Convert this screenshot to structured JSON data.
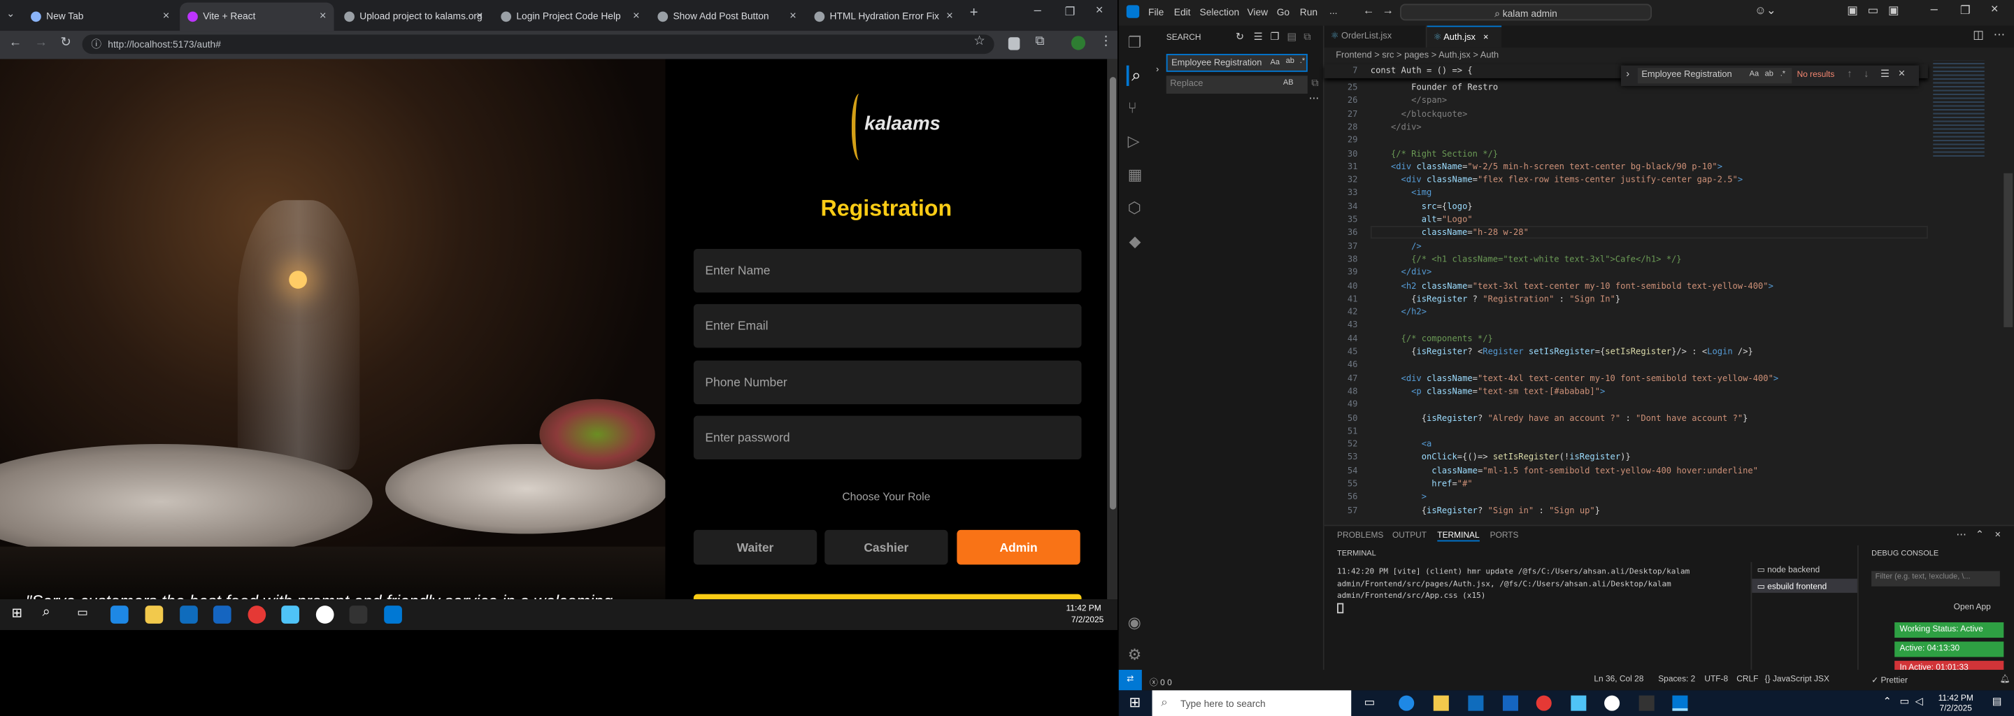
{
  "browser": {
    "tabs": [
      {
        "label": "New Tab",
        "favicon_color": "#8ab4f8"
      },
      {
        "label": "Vite + React",
        "favicon_color": "#bd34fe"
      },
      {
        "label": "Upload project to kalams.org",
        "favicon_color": "#9aa0a6"
      },
      {
        "label": "Login Project Code Help",
        "favicon_color": "#9aa0a6"
      },
      {
        "label": "Show Add Post Button",
        "favicon_color": "#9aa0a6"
      },
      {
        "label": "HTML Hydration Error Fix",
        "favicon_color": "#9aa0a6"
      }
    ],
    "new_tab": "+",
    "url": "http://localhost:5173/auth#"
  },
  "app": {
    "logo_text": "kalaams",
    "heading": "Registration",
    "name_placeholder": "Enter Name",
    "email_placeholder": "Enter Email",
    "phone_placeholder": "Phone Number",
    "password_placeholder": "Enter password",
    "role_label": "Choose Your Role",
    "roles": [
      "Waiter",
      "Cashier",
      "Admin"
    ],
    "selected_role": "Admin",
    "quote": "\"Serve customers the best food with prompt and friendly service in a welcoming",
    "accent": "#f97316",
    "heading_color": "#facc15"
  },
  "taskbar_small": {
    "time": "11:42 PM",
    "date": "7/2/2025"
  },
  "vscode": {
    "menu": [
      "File",
      "Edit",
      "Selection",
      "View",
      "Go",
      "Run",
      "..."
    ],
    "search_box": "kalam admin",
    "tabs": [
      "OrderList.jsx",
      "Auth.jsx"
    ],
    "breadcrumb": "Frontend > src > pages > Auth.jsx > Auth",
    "search": {
      "title": "SEARCH",
      "query": "Employee Registration",
      "replace_placeholder": "Replace",
      "replace_btn": "AB"
    },
    "find": {
      "query": "Employee Registration",
      "result": "No results",
      "opt_case": "Aa",
      "opt_word": "ab",
      "opt_regex": ".*"
    },
    "sticky": "const Auth = () => {",
    "sticky_ln": "7",
    "lines": [
      {
        "n": "25",
        "c": [
          [
            "    ",
            "tx"
          ],
          [
            "Founder of Restro",
            "tx"
          ]
        ]
      },
      {
        "n": "26",
        "c": [
          [
            "    ",
            "tx"
          ],
          [
            "</span>",
            "t"
          ]
        ]
      },
      {
        "n": "27",
        "c": [
          [
            "  ",
            "tx"
          ],
          [
            "</blockquote>",
            "t"
          ]
        ]
      },
      {
        "n": "28",
        "c": [
          [
            "</div>",
            "t"
          ]
        ]
      },
      {
        "n": "29",
        "c": [
          [
            "",
            "tx"
          ]
        ]
      },
      {
        "n": "30",
        "c": [
          [
            "{/* Right Section */}",
            "cm"
          ]
        ]
      },
      {
        "n": "31",
        "c": [
          [
            "<div ",
            "tg"
          ],
          [
            "className",
            "at"
          ],
          [
            "=",
            "tx"
          ],
          [
            "\"w-2/5 min-h-screen text-center bg-black/90 p-10\"",
            "st"
          ],
          [
            ">",
            "tg"
          ]
        ]
      },
      {
        "n": "32",
        "c": [
          [
            "  <div ",
            "tg"
          ],
          [
            "className",
            "at"
          ],
          [
            "=",
            "tx"
          ],
          [
            "\"flex flex-row items-center justify-center gap-2.5\"",
            "st"
          ],
          [
            ">",
            "tg"
          ]
        ]
      },
      {
        "n": "33",
        "c": [
          [
            "    <img",
            "tg"
          ]
        ]
      },
      {
        "n": "34",
        "c": [
          [
            "      src",
            "at"
          ],
          [
            "={",
            "tx"
          ],
          [
            "logo",
            "at"
          ],
          [
            "}",
            "tx"
          ]
        ]
      },
      {
        "n": "35",
        "c": [
          [
            "      alt",
            "at"
          ],
          [
            "=",
            "tx"
          ],
          [
            "\"Logo\"",
            "st"
          ]
        ]
      },
      {
        "n": "36",
        "c": [
          [
            "      className",
            "at"
          ],
          [
            "=",
            "tx"
          ],
          [
            "\"h-28 w-28\"",
            "st"
          ]
        ]
      },
      {
        "n": "37",
        "c": [
          [
            "    />",
            "tg"
          ]
        ]
      },
      {
        "n": "38",
        "c": [
          [
            "    {/* <h1 className=\"text-white text-3xl\">Cafe</h1> */}",
            "cm"
          ]
        ]
      },
      {
        "n": "39",
        "c": [
          [
            "  </div>",
            "tg"
          ]
        ]
      },
      {
        "n": "40",
        "c": [
          [
            "  <h2 ",
            "tg"
          ],
          [
            "className",
            "at"
          ],
          [
            "=",
            "tx"
          ],
          [
            "\"text-3xl text-center my-10 font-semibold text-yellow-400\"",
            "st"
          ],
          [
            ">",
            "tg"
          ]
        ]
      },
      {
        "n": "41",
        "c": [
          [
            "    {",
            "tx"
          ],
          [
            "isRegister",
            "at"
          ],
          [
            " ? ",
            "tx"
          ],
          [
            "\"Registration\"",
            "st"
          ],
          [
            " : ",
            "tx"
          ],
          [
            "\"Sign In\"",
            "st"
          ],
          [
            "}",
            "tx"
          ]
        ]
      },
      {
        "n": "42",
        "c": [
          [
            "  </h2>",
            "tg"
          ]
        ]
      },
      {
        "n": "43",
        "c": [
          [
            "",
            "tx"
          ]
        ]
      },
      {
        "n": "44",
        "c": [
          [
            "  {/* components */}",
            "cm"
          ]
        ]
      },
      {
        "n": "45",
        "c": [
          [
            "    {",
            "tx"
          ],
          [
            "isRegister",
            "at"
          ],
          [
            "? <",
            "tx"
          ],
          [
            "Register ",
            "tg"
          ],
          [
            "setIsRegister",
            "at"
          ],
          [
            "={",
            "tx"
          ],
          [
            "setIsRegister",
            "fn"
          ],
          [
            "}/> : <",
            "tx"
          ],
          [
            "Login",
            "tg"
          ],
          [
            " />}",
            "tx"
          ]
        ]
      },
      {
        "n": "46",
        "c": [
          [
            "",
            "tx"
          ]
        ]
      },
      {
        "n": "47",
        "c": [
          [
            "  <div ",
            "tg"
          ],
          [
            "className",
            "at"
          ],
          [
            "=",
            "tx"
          ],
          [
            "\"text-4xl text-center my-10 font-semibold text-yellow-400\"",
            "st"
          ],
          [
            ">",
            "tg"
          ]
        ]
      },
      {
        "n": "48",
        "c": [
          [
            "    <p ",
            "tg"
          ],
          [
            "className",
            "at"
          ],
          [
            "=",
            "tx"
          ],
          [
            "\"text-sm text-[#ababab]\"",
            "st"
          ],
          [
            ">",
            "tg"
          ]
        ]
      },
      {
        "n": "49",
        "c": [
          [
            "",
            "tx"
          ]
        ]
      },
      {
        "n": "50",
        "c": [
          [
            "      {",
            "tx"
          ],
          [
            "isRegister",
            "at"
          ],
          [
            "? ",
            "tx"
          ],
          [
            "\"Alredy have an account ?\"",
            "st"
          ],
          [
            " : ",
            "tx"
          ],
          [
            "\"Dont have account ?\"",
            "st"
          ],
          [
            "}",
            "tx"
          ]
        ]
      },
      {
        "n": "51",
        "c": [
          [
            "",
            "tx"
          ]
        ]
      },
      {
        "n": "52",
        "c": [
          [
            "      <a",
            "tg"
          ]
        ]
      },
      {
        "n": "53",
        "c": [
          [
            "      onClick",
            "at"
          ],
          [
            "={()=> ",
            "tx"
          ],
          [
            "setIsRegister",
            "fn"
          ],
          [
            "(!",
            "tx"
          ],
          [
            "isRegister",
            "at"
          ],
          [
            ")}",
            "tx"
          ]
        ]
      },
      {
        "n": "54",
        "c": [
          [
            "        className",
            "at"
          ],
          [
            "=",
            "tx"
          ],
          [
            "\"ml-1.5 font-semibold text-yellow-400 hover:underline\"",
            "st"
          ]
        ]
      },
      {
        "n": "55",
        "c": [
          [
            "        href",
            "at"
          ],
          [
            "=",
            "tx"
          ],
          [
            "\"#\"",
            "st"
          ]
        ]
      },
      {
        "n": "56",
        "c": [
          [
            "      >",
            "tg"
          ]
        ]
      },
      {
        "n": "57",
        "c": [
          [
            "      {",
            "tx"
          ],
          [
            "isRegister",
            "at"
          ],
          [
            "? ",
            "tx"
          ],
          [
            "\"Sign in\"",
            "st"
          ],
          [
            " : ",
            "tx"
          ],
          [
            "\"Sign up\"",
            "st"
          ],
          [
            "}",
            "tx"
          ]
        ]
      }
    ],
    "panel_tabs": [
      "PROBLEMS",
      "OUTPUT",
      "TERMINAL",
      "PORTS"
    ],
    "terminal_title": "TERMINAL",
    "terminal_text": "11:42:20 PM [vite] (client) hmr update /@fs/C:/Users/ahsan.ali/Desktop/kalam admin/Frontend/src/pages/Auth.jsx, /@fs/C:/Users/ahsan.ali/Desktop/kalam admin/Frontend/src/App.css (x15)",
    "terminals": [
      {
        "name": "node",
        "label": "backend"
      },
      {
        "name": "esbuild",
        "label": "frontend"
      }
    ],
    "debug_title": "DEBUG CONSOLE",
    "debug_filter": "Filter (e.g. text, !exclude, \\...",
    "open_app": "Open App",
    "working_status": "Working Status: Active",
    "active": "Active: 04:13:30",
    "inactive": "In Active: 01:01:33",
    "status_left": "0  0",
    "status_right": [
      "Ln 36, Col 28",
      "Spaces: 2",
      "UTF-8",
      "CRLF",
      "{} JavaScript JSX"
    ],
    "prettier": "Prettier"
  },
  "windows_taskbar": {
    "search_placeholder": "Type here to search",
    "time": "11:42 PM",
    "date": "7/2/2025"
  }
}
